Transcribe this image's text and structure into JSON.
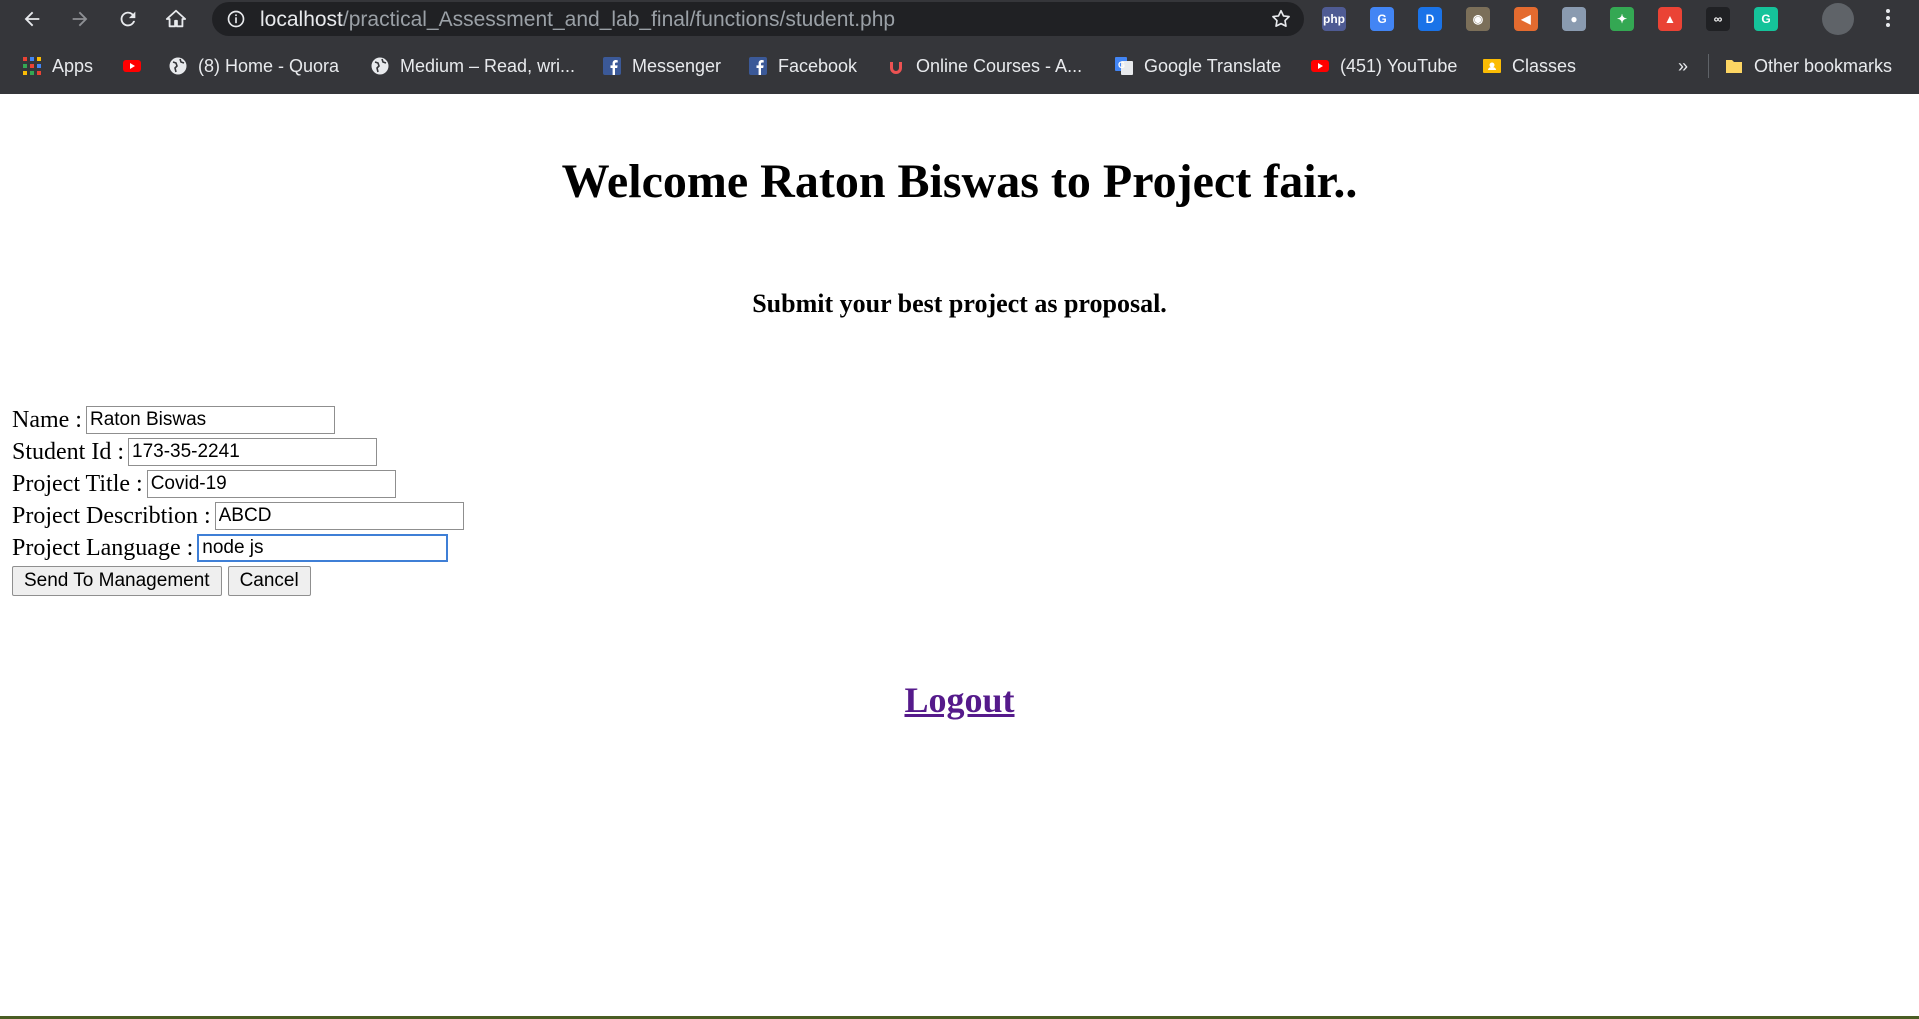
{
  "browser": {
    "url_host": "localhost",
    "url_path": "/practical_Assessment_and_lab_final/functions/student.php",
    "extensions": [
      {
        "name": "php-icon",
        "label": "php",
        "color": "#4f5b93"
      },
      {
        "name": "google-translate-ext-icon",
        "label": "G",
        "color": "#4285f4"
      },
      {
        "name": "d-ext-icon",
        "label": "D",
        "color": "#1a73e8"
      },
      {
        "name": "eyes-ext-icon",
        "label": "◉",
        "color": "#7b6f59"
      },
      {
        "name": "megaphone-ext-icon",
        "label": "◀",
        "color": "#e46b2f"
      },
      {
        "name": "circle-ext-icon",
        "label": "●",
        "color": "#8a9bb0"
      },
      {
        "name": "colorful-ext-icon",
        "label": "✦",
        "color": "#34a853"
      },
      {
        "name": "lighthouse-ext-icon",
        "label": "▲",
        "color": "#ea4335"
      },
      {
        "name": "infinity-ext-icon",
        "label": "∞",
        "color": "#202124"
      },
      {
        "name": "grammarly-ext-icon",
        "label": "G",
        "color": "#15c39a"
      }
    ]
  },
  "bookmarks": [
    {
      "label": "Apps",
      "icon": "apps-grid-icon"
    },
    {
      "label": "",
      "icon": "youtube-icon"
    },
    {
      "label": "(8) Home - Quora",
      "icon": "globe-icon"
    },
    {
      "label": "Medium – Read, wri...",
      "icon": "globe-icon"
    },
    {
      "label": "Messenger",
      "icon": "facebook-icon"
    },
    {
      "label": "Facebook",
      "icon": "facebook-icon"
    },
    {
      "label": "Online Courses - A...",
      "icon": "udemy-icon"
    },
    {
      "label": "Google Translate",
      "icon": "google-translate-icon"
    },
    {
      "label": "(451) YouTube",
      "icon": "youtube-icon"
    },
    {
      "label": "Classes",
      "icon": "classroom-icon"
    }
  ],
  "bookmarks_overflow": "»",
  "other_bookmarks": "Other bookmarks",
  "page": {
    "welcome": "Welcome Raton Biswas to Project fair..",
    "subtitle": "Submit your best project as proposal.",
    "form": {
      "name_label": "Name :",
      "name_value": "Raton Biswas",
      "id_label": "Student Id :",
      "id_value": "173-35-2241",
      "title_label": "Project Title :",
      "title_value": "Covid-19",
      "desc_label": "Project Describtion :",
      "desc_value": "ABCD",
      "lang_label": "Project Language :",
      "lang_value": "node js",
      "submit_label": "Send To Management",
      "cancel_label": "Cancel"
    },
    "logout": "Logout"
  }
}
